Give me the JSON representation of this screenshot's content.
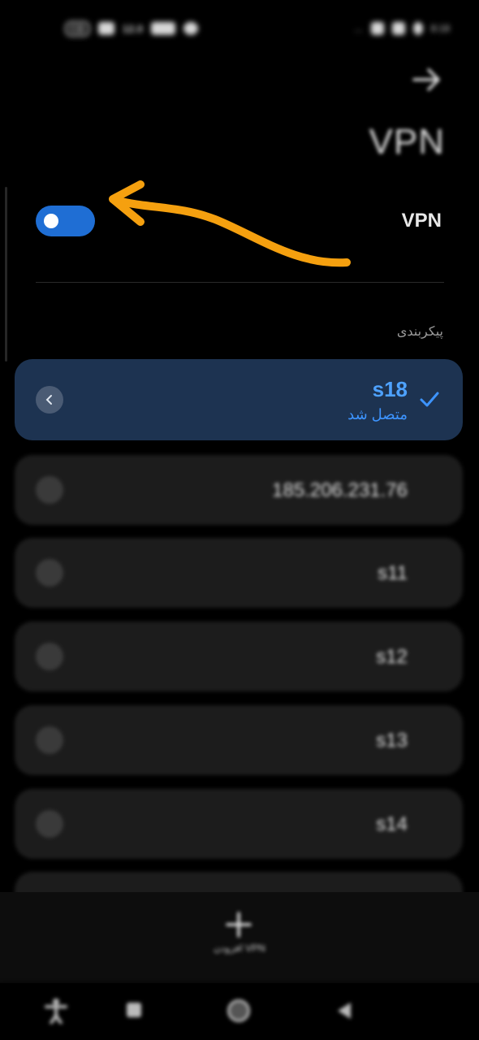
{
  "status_bar": {
    "left_items": [
      "CD",
      "wifi-icon",
      "12.0",
      "dual-sim-icon",
      "settings-icon"
    ],
    "right_items": [
      "...",
      "signal-1-icon",
      "signal-2-icon",
      "battery-icon",
      "8:18"
    ]
  },
  "header": {
    "title": "VPN",
    "back_icon": "arrow-right-icon"
  },
  "vpn_toggle": {
    "label": "VPN",
    "enabled": true,
    "accent_color": "#1f6ed4"
  },
  "annotation": {
    "type": "hand-drawn-arrow",
    "color": "#f5a00f"
  },
  "section": {
    "label": "پیکربندی"
  },
  "profiles": [
    {
      "name": "s18",
      "status": "متصل شد",
      "active": true
    },
    {
      "name": "185.206.231.76",
      "status": "",
      "active": false
    },
    {
      "name": "s11",
      "status": "",
      "active": false
    },
    {
      "name": "s12",
      "status": "",
      "active": false
    },
    {
      "name": "s13",
      "status": "",
      "active": false
    },
    {
      "name": "s14",
      "status": "",
      "active": false
    }
  ],
  "add_button": {
    "label": "افزودن VPN",
    "icon": "plus-icon"
  },
  "nav_bar": {
    "items": [
      "accessibility-icon",
      "recents-icon",
      "home-icon",
      "back-icon"
    ]
  },
  "colors": {
    "background": "#000000",
    "card": "#1c1c1c",
    "active_card": "#1d3351",
    "active_text": "#4ea2ff"
  }
}
